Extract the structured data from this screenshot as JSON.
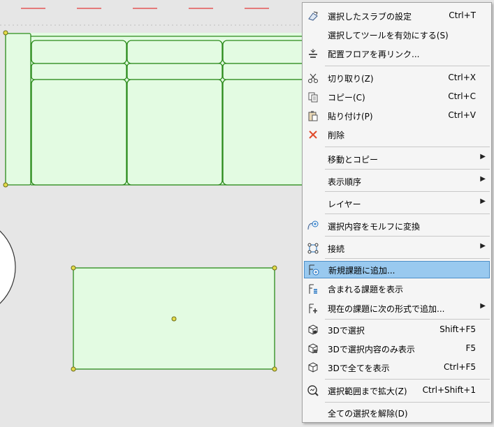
{
  "colors": {
    "canvas_bg": "#e6e6e6",
    "shape_fill": "#e3fbe2",
    "shape_stroke": "#2a8a1a",
    "handle": "#e3dc4a",
    "highlight": "#99c9ef",
    "dash_red": "#e23b3b"
  },
  "menu": {
    "items": [
      {
        "label": "選択したスラブの設定",
        "shortcut": "Ctrl+T",
        "icon": "slab-settings-icon"
      },
      {
        "label": "選択してツールを有効にする(S)",
        "shortcut": "",
        "icon": ""
      },
      {
        "label": "配置フロアを再リンク...",
        "shortcut": "",
        "icon": "relink-floor-icon"
      },
      {
        "label": "切り取り(Z)",
        "shortcut": "Ctrl+X",
        "icon": "scissors-icon"
      },
      {
        "label": "コピー(C)",
        "shortcut": "Ctrl+C",
        "icon": "copy-icon"
      },
      {
        "label": "貼り付け(P)",
        "shortcut": "Ctrl+V",
        "icon": "paste-icon"
      },
      {
        "label": "削除",
        "shortcut": "",
        "icon": "delete-x-icon"
      },
      {
        "label": "移動とコピー",
        "shortcut": "",
        "icon": "",
        "submenu": true
      },
      {
        "label": "表示順序",
        "shortcut": "",
        "icon": "",
        "submenu": true
      },
      {
        "label": "レイヤー",
        "shortcut": "",
        "icon": "",
        "submenu": true
      },
      {
        "label": "選択内容をモルフに変換",
        "shortcut": "",
        "icon": "morph-convert-icon"
      },
      {
        "label": "接続",
        "shortcut": "",
        "icon": "connect-icon",
        "submenu": true
      },
      {
        "label": "新規課題に追加...",
        "shortcut": "",
        "icon": "add-issue-icon",
        "highlighted": true
      },
      {
        "label": "含まれる課題を表示",
        "shortcut": "",
        "icon": "show-issues-icon"
      },
      {
        "label": "現在の課題に次の形式で追加...",
        "shortcut": "",
        "icon": "add-current-issue-icon",
        "submenu": true
      },
      {
        "label": "3Dで選択",
        "shortcut": "Shift+F5",
        "icon": "cube-3d-icon"
      },
      {
        "label": "3Dで選択内容のみ表示",
        "shortcut": "F5",
        "icon": "cube-3d-only-icon"
      },
      {
        "label": "3Dで全てを表示",
        "shortcut": "Ctrl+F5",
        "icon": "cube-3d-all-icon"
      },
      {
        "label": "選択範囲まで拡大(Z)",
        "shortcut": "Ctrl+Shift+1",
        "icon": "zoom-selection-icon"
      },
      {
        "label": "全ての選択を解除(D)",
        "shortcut": "",
        "icon": ""
      }
    ]
  }
}
